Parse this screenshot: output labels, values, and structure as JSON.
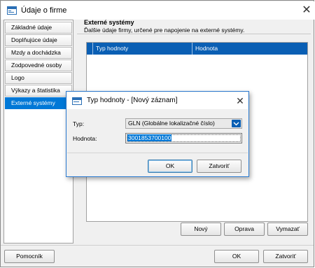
{
  "window": {
    "title": "Údaje o firme",
    "close_icon": "✕"
  },
  "menu": {
    "items": [
      {
        "label": "Základné údaje",
        "active": false
      },
      {
        "label": "Doplňujúce údaje",
        "active": false
      },
      {
        "label": "Mzdy a dochádzka",
        "active": false
      },
      {
        "label": "Zodpovedné osoby",
        "active": false
      },
      {
        "label": "Logo",
        "active": false
      },
      {
        "label": "Výkazy a štatistika",
        "active": false
      },
      {
        "label": "Externé systémy",
        "active": true
      }
    ]
  },
  "panel": {
    "title": "Externé systémy",
    "subtitle": "Ďalšie údaje firmy, určené pre napojenie na externé systémy.",
    "table": {
      "columns": [
        "Typ hodnoty",
        "Hodnota"
      ]
    },
    "buttons": {
      "new": "Nový",
      "edit": "Oprava",
      "delete": "Vymazať"
    }
  },
  "footer": {
    "help": "Pomocník",
    "ok": "OK",
    "close": "Zatvoriť"
  },
  "dialog": {
    "title": "Typ hodnoty - [Nový záznam]",
    "close_icon": "✕",
    "type_label": "Typ:",
    "type_value": "GLN (Globálne lokalizačné číslo)",
    "value_label": "Hodnota:",
    "value": "3001853700100",
    "ok": "OK",
    "close": "Zatvoriť"
  },
  "colors": {
    "accent": "#0078d7",
    "header_blue": "#0a5fb4",
    "dialog_border": "#2b7bd2"
  }
}
